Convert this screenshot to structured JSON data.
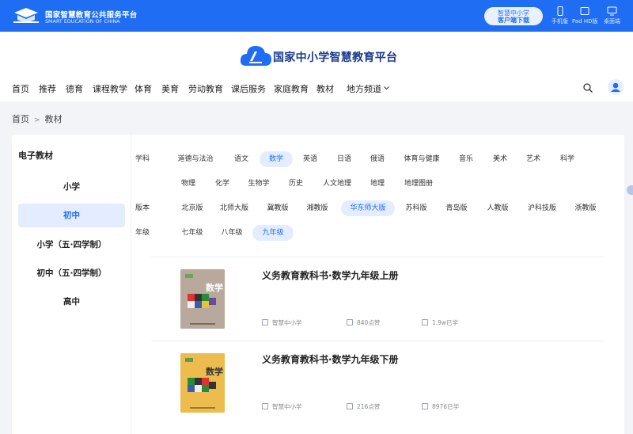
{
  "topbar": {
    "brand_cn": "国家智慧教育公共服务平台",
    "brand_en": "SMART EDUCATION OF CHINA",
    "client_line1": "智慧中小学",
    "client_line2": "客户端下载",
    "devices": [
      "手机版",
      "Pad HD版",
      "桌面端"
    ]
  },
  "header": {
    "site_title": "国家中小学智慧教育平台",
    "nav": [
      "首页",
      "推荐",
      "德育",
      "课程教学",
      "体育",
      "美育",
      "劳动教育",
      "课后服务",
      "家庭教育",
      "教材",
      "地方频道"
    ]
  },
  "breadcrumb": {
    "home": "首页",
    "sep": ">",
    "current": "教材"
  },
  "sidebar": {
    "title": "电子教材",
    "items": [
      "小学",
      "初中",
      "小学（五·四学制）",
      "初中（五·四学制）",
      "高中"
    ],
    "active": "初中"
  },
  "filters": {
    "subject_label": "学科",
    "subjects_row1": [
      "道德与法治",
      "语文",
      "数学",
      "英语",
      "日语",
      "俄语",
      "体育与健康",
      "音乐",
      "美术",
      "艺术",
      "科学"
    ],
    "subjects_row2": [
      "物理",
      "化学",
      "生物学",
      "历史",
      "人文地理",
      "地理",
      "地理图册"
    ],
    "subject_selected": "数学",
    "edition_label": "版本",
    "editions": [
      "北京版",
      "北师大版",
      "冀教版",
      "湘教版",
      "华东师大版",
      "苏科版",
      "青岛版",
      "人教版",
      "沪科技版",
      "浙教版"
    ],
    "edition_selected": "华东师大版",
    "grade_label": "年级",
    "grades": [
      "七年级",
      "八年级",
      "九年级"
    ],
    "grade_selected": "九年级"
  },
  "books": [
    {
      "title": "义务教育教科书·数学九年级上册",
      "publisher": "智慧中小学",
      "likes": "840点赞",
      "learners": "1.9w已学",
      "cover_text": "数学",
      "cover_color": "#b7a79a"
    },
    {
      "title": "义务教育教科书·数学九年级下册",
      "publisher": "智慧中小学",
      "likes": "216点赞",
      "learners": "8976已学",
      "cover_text": "数学",
      "cover_color": "#e9b84a"
    }
  ],
  "colors": {
    "primary": "#1f6df2",
    "selected_bg": "#e4edff",
    "title_blue": "#1a3a8c"
  }
}
